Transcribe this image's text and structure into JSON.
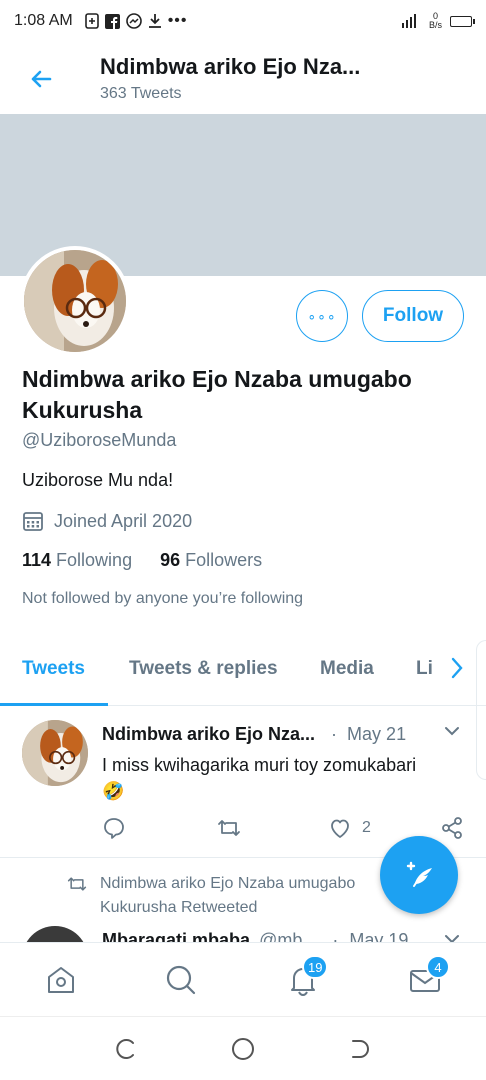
{
  "status_bar": {
    "time": "1:08 AM",
    "notification_icons": [
      "plus-box-icon",
      "facebook-icon",
      "messenger-icon",
      "download-icon",
      "more-dots-icon"
    ],
    "more_dots": "•••",
    "net_speed_value": "0",
    "net_speed_unit": "B/s"
  },
  "header": {
    "title": "Ndimbwa ariko Ejo Nza...",
    "tweet_count": "363 Tweets"
  },
  "profile": {
    "name": "Ndimbwa ariko Ejo Nzaba umugabo Kukurusha",
    "handle": "@UziboroseMunda",
    "bio": "Uziborose Mu nda!",
    "joined": "Joined April 2020",
    "following_count": "114",
    "following_label": "Following",
    "followers_count": "96",
    "followers_label": "Followers",
    "not_followed_text": "Not followed by anyone you’re following",
    "more_button": "∘∘∘",
    "follow_button": "Follow"
  },
  "tabs": [
    {
      "label": "Tweets",
      "active": true
    },
    {
      "label": "Tweets & replies",
      "active": false
    },
    {
      "label": "Media",
      "active": false
    },
    {
      "label": "Li",
      "active": false
    }
  ],
  "tweets": [
    {
      "name": "Ndimbwa ariko Ejo Nza...",
      "separator": "·",
      "date": "May 21",
      "text": "I miss kwihagarika muri toy zomukabari",
      "emoji": "🤣",
      "likes": "2"
    }
  ],
  "retweet_notice": "Ndimbwa ariko Ejo Nzaba umugabo Kukurusha Retweeted",
  "next_tweet": {
    "name": "Mbaragati mbaba",
    "handle": "@mb...",
    "separator": "·",
    "date": "May 19"
  },
  "bottom_nav": {
    "notifications_badge": "19",
    "messages_badge": "4"
  },
  "colors": {
    "accent": "#1da1f2",
    "banner": "#ccd6dd",
    "secondary_text": "#657786"
  }
}
